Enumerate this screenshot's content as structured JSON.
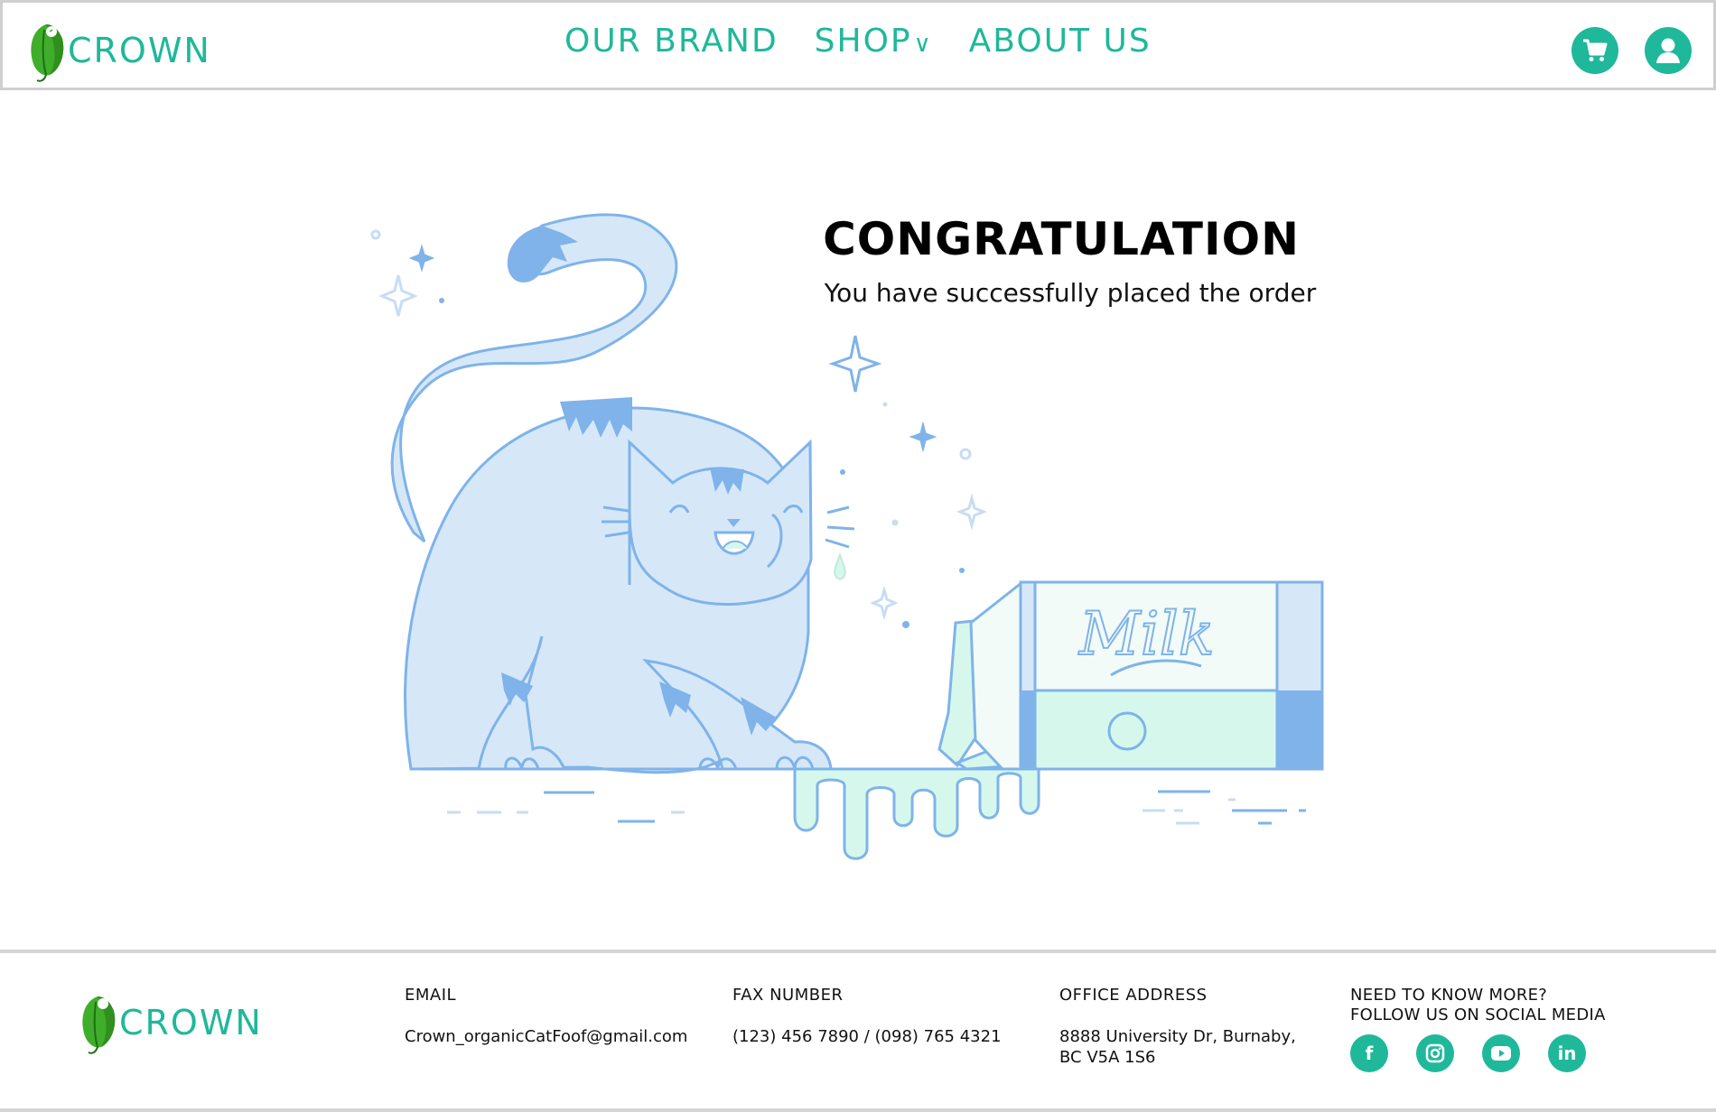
{
  "header": {
    "brand": "CROWN",
    "nav": [
      {
        "label": "OUR BRAND"
      },
      {
        "label": "SHOP",
        "chevron": "∨"
      },
      {
        "label": "ABOUT US"
      }
    ],
    "icons": [
      "cart-icon",
      "user-icon"
    ]
  },
  "main": {
    "title": "CONGRATULATION",
    "subtitle": "You have successfully placed the order",
    "illustration": {
      "carton_label": "Milk"
    }
  },
  "footer": {
    "brand": "CROWN",
    "email": {
      "label": "EMAIL",
      "value": "Crown_organicCatFoof@gmail.com"
    },
    "fax": {
      "label": "FAX NUMBER",
      "value": "(123) 456 7890 / (098) 765 4321"
    },
    "office": {
      "label": "OFFICE ADDRESS",
      "line1": "8888 University Dr, Burnaby,",
      "line2": "BC V5A 1S6"
    },
    "social": {
      "line1": "NEED TO KNOW MORE?",
      "line2": "FOLLOW US ON SOCIAL MEDIA",
      "icons": [
        {
          "name": "facebook-icon",
          "glyph": "f"
        },
        {
          "name": "instagram-icon",
          "glyph": ""
        },
        {
          "name": "youtube-icon",
          "glyph": ""
        },
        {
          "name": "linkedin-icon",
          "glyph": "in"
        }
      ]
    }
  },
  "colors": {
    "brand": "#1fb89a",
    "leaf": "#3fae2a",
    "cat_fill": "#d6e8f8",
    "cat_stroke": "#7fb3ea",
    "milk": "#d6f8ec"
  }
}
